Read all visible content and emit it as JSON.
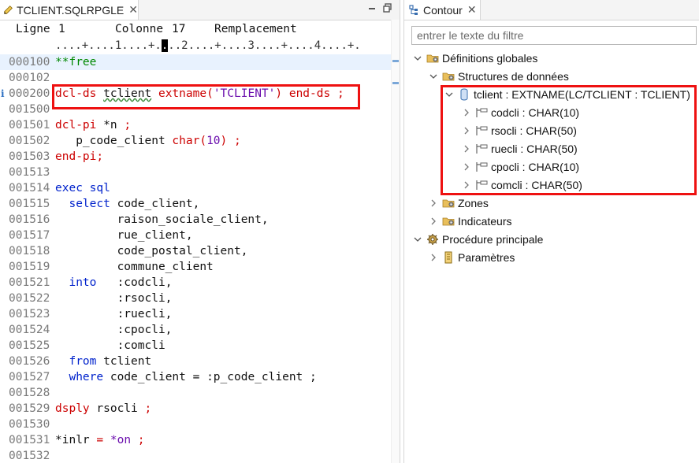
{
  "editor": {
    "tab_label": "TCLIENT.SQLRPGLE",
    "close_glyph": "✕",
    "status": {
      "ligne_label": "Ligne",
      "ligne_value": "1",
      "colonne_label": "Colonne",
      "colonne_value": "17",
      "mode": "Remplacement"
    },
    "ruler_before": "....+....1....+.",
    "ruler_cursor": ".",
    "ruler_after": "..2....+....3....+....4....+.",
    "lines": [
      {
        "num": "000100",
        "text": "**free"
      },
      {
        "num": "000102",
        "text": ""
      },
      {
        "num": "000200",
        "text": "dcl-ds tclient extname('TCLIENT') end-ds ;"
      },
      {
        "num": "001500",
        "text": ""
      },
      {
        "num": "001501",
        "text": "dcl-pi *n ;"
      },
      {
        "num": "001502",
        "text": "   p_code_client char(10) ;"
      },
      {
        "num": "001503",
        "text": "end-pi;"
      },
      {
        "num": "001513",
        "text": ""
      },
      {
        "num": "001514",
        "text": "exec sql"
      },
      {
        "num": "001515",
        "text": "  select code_client,"
      },
      {
        "num": "001516",
        "text": "         raison_sociale_client,"
      },
      {
        "num": "001517",
        "text": "         rue_client,"
      },
      {
        "num": "001518",
        "text": "         code_postal_client,"
      },
      {
        "num": "001519",
        "text": "         commune_client"
      },
      {
        "num": "001521",
        "text": "  into   :codcli,"
      },
      {
        "num": "001522",
        "text": "         :rsocli,"
      },
      {
        "num": "001523",
        "text": "         :ruecli,"
      },
      {
        "num": "001524",
        "text": "         :cpocli,"
      },
      {
        "num": "001525",
        "text": "         :comcli"
      },
      {
        "num": "001526",
        "text": "  from tclient"
      },
      {
        "num": "001527",
        "text": "  where code_client = :p_code_client ;"
      },
      {
        "num": "001528",
        "text": ""
      },
      {
        "num": "001529",
        "text": "dsply rsocli ;"
      },
      {
        "num": "001530",
        "text": ""
      },
      {
        "num": "001531",
        "text": "*inlr = *on ;"
      },
      {
        "num": "001532",
        "text": ""
      }
    ],
    "annotation_marker": "i"
  },
  "outline": {
    "tab_label": "Contour",
    "filter_placeholder": "entrer le texte du filtre",
    "nodes": [
      {
        "label": "Définitions globales"
      },
      {
        "label": "Structures de données"
      },
      {
        "label": "tclient : EXTNAME(LC/TCLIENT : TCLIENT)"
      },
      {
        "label": "codcli : CHAR(10)"
      },
      {
        "label": "rsocli : CHAR(50)"
      },
      {
        "label": "ruecli : CHAR(50)"
      },
      {
        "label": "cpocli : CHAR(10)"
      },
      {
        "label": "comcli : CHAR(50)"
      },
      {
        "label": "Zones"
      },
      {
        "label": "Indicateurs"
      },
      {
        "label": "Procédure principale"
      },
      {
        "label": "Paramètres"
      }
    ]
  },
  "colors": {
    "keyword": "#0022cc",
    "highlight_box": "#ee1111",
    "string": "#cc0000",
    "comment_free": "#008800",
    "current_line": "#e8f2fe"
  },
  "icons": {
    "editor_tab": "pencil-file-icon",
    "outline_tab": "outline-icon",
    "folder": "folder-gear-icon",
    "data_structure": "database-icon",
    "field": "field-icon",
    "procedure": "gear-icon",
    "parameters": "parameter-icon"
  }
}
